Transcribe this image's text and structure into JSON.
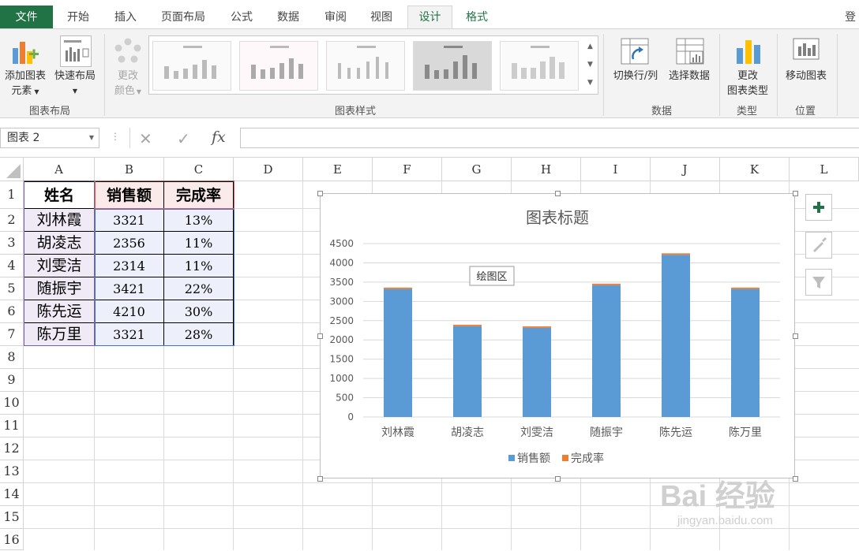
{
  "ribbon_tabs": [
    {
      "label": "文件",
      "kind": "file"
    },
    {
      "label": "开始"
    },
    {
      "label": "插入"
    },
    {
      "label": "页面布局"
    },
    {
      "label": "公式"
    },
    {
      "label": "数据"
    },
    {
      "label": "审阅"
    },
    {
      "label": "视图"
    },
    {
      "label": "设计",
      "kind": "active"
    },
    {
      "label": "格式",
      "kind": "ctx"
    }
  ],
  "account_label": "登",
  "ribbon": {
    "add_element": {
      "line1": "添加图表",
      "line2": "元素"
    },
    "quick_layout": "快速布局",
    "change_colors": {
      "line1": "更改",
      "line2": "颜色"
    },
    "switch_rowcol": "切换行/列",
    "select_data": "选择数据",
    "change_type": {
      "line1": "更改",
      "line2": "图表类型"
    },
    "move_chart": "移动图表",
    "groups": {
      "layouts": "图表布局",
      "styles": "图表样式",
      "data": "数据",
      "type": "类型",
      "location": "位置"
    }
  },
  "formula_bar": {
    "name_box": "图表 2",
    "cancel": "✕",
    "enter": "✓",
    "fx": "fx",
    "value": ""
  },
  "columns": [
    "A",
    "B",
    "C",
    "D",
    "E",
    "F",
    "G",
    "H",
    "I",
    "J",
    "K",
    "L"
  ],
  "rows": [
    "1",
    "2",
    "3",
    "4",
    "5",
    "6",
    "7",
    "8",
    "9",
    "10",
    "11",
    "12",
    "13",
    "14",
    "15",
    "16"
  ],
  "table": {
    "headers": [
      "姓名",
      "销售额",
      "完成率"
    ],
    "rows": [
      [
        "刘林霞",
        "3321",
        "13%"
      ],
      [
        "胡凌志",
        "2356",
        "11%"
      ],
      [
        "刘雯洁",
        "2314",
        "11%"
      ],
      [
        "随振宇",
        "3421",
        "22%"
      ],
      [
        "陈先运",
        "4210",
        "30%"
      ],
      [
        "陈万里",
        "3321",
        "28%"
      ]
    ]
  },
  "chart_data": {
    "type": "bar",
    "stacked": true,
    "title": "图表标题",
    "categories": [
      "刘林霞",
      "胡凌志",
      "刘雯洁",
      "随振宇",
      "陈先运",
      "陈万里"
    ],
    "series": [
      {
        "name": "销售额",
        "values": [
          3321,
          2356,
          2314,
          3421,
          4210,
          3321
        ],
        "color": "#5b9bd5"
      },
      {
        "name": "完成率",
        "values": [
          0.13,
          0.11,
          0.11,
          0.22,
          0.3,
          0.28
        ],
        "color": "#ed7d31"
      }
    ],
    "ylim": [
      0,
      4500
    ],
    "yticks": [
      "0",
      "500",
      "1000",
      "1500",
      "2000",
      "2500",
      "3000",
      "3500",
      "4000",
      "4500"
    ],
    "grid": true,
    "legend": "bottom",
    "tooltip": "绘图区"
  },
  "colors": {
    "excel_green": "#217346",
    "series1": "#5b9bd5",
    "series2": "#ed7d31"
  },
  "watermark": {
    "brand": "Bai 经验",
    "url": "jingyan.baidu.com"
  }
}
